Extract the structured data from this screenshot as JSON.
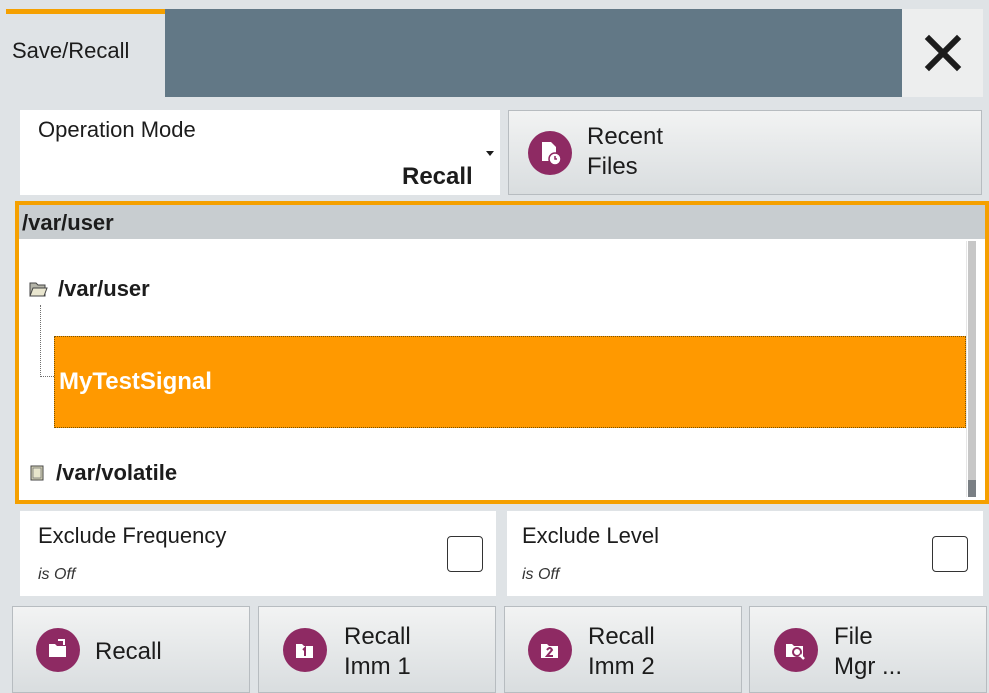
{
  "dialog": {
    "tab_title": "Save/Recall",
    "close_icon": "close-icon"
  },
  "operation_mode": {
    "label": "Operation Mode",
    "value": "Recall"
  },
  "recent_files": {
    "line1": "Recent",
    "line2": "Files",
    "icon": "recent-files-icon"
  },
  "browser": {
    "current_path": "/var/user",
    "tree": [
      {
        "label": "/var/user",
        "icon": "open-folder-icon"
      },
      {
        "label": "MyTestSignal",
        "selected": true
      },
      {
        "label": "/var/volatile",
        "icon": "folder-icon"
      }
    ]
  },
  "exclude_frequency": {
    "label": "Exclude Frequency",
    "state": "is Off"
  },
  "exclude_level": {
    "label": "Exclude Level",
    "state": "is Off"
  },
  "buttons": {
    "recall": "Recall",
    "recall_imm1_l1": "Recall",
    "recall_imm1_l2": "Imm 1",
    "recall_imm2_l1": "Recall",
    "recall_imm2_l2": "Imm 2",
    "file_mgr_l1": "File",
    "file_mgr_l2": "Mgr ..."
  },
  "colors": {
    "accent": "#f5a000",
    "selection": "#ff9900",
    "icon_bg": "#8e2a63",
    "title_bar": "#627886"
  }
}
